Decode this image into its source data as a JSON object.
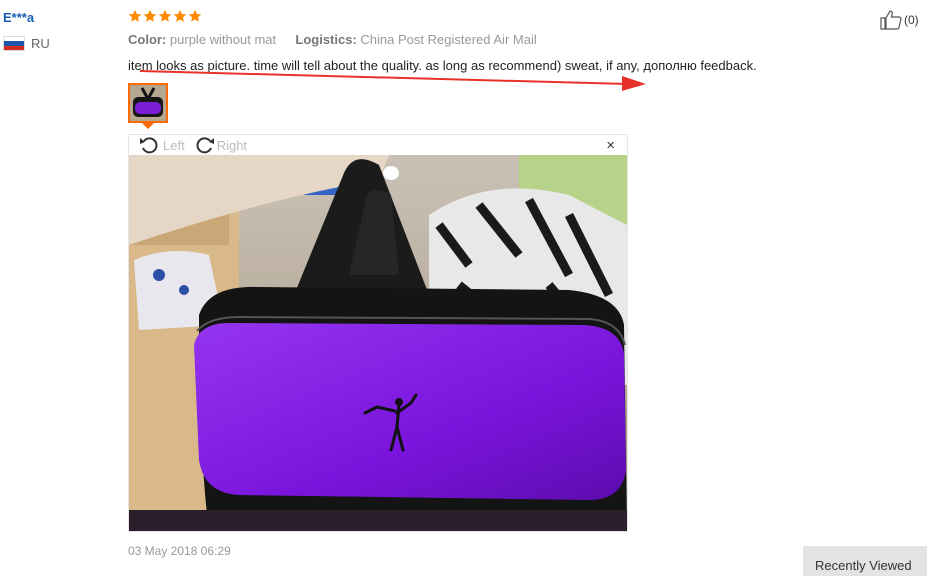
{
  "review": {
    "user_name": "E***a",
    "country_code": "RU",
    "rating": 5,
    "color_label": "Color:",
    "color_value": "purple without mat",
    "logistics_label": "Logistics:",
    "logistics_value": "China Post Registered Air Mail",
    "text": "item looks as picture. time will tell about the quality. as long as recommend) sweat, if any, дополню feedback.",
    "likes": "(0)",
    "date": "03 May 2018 06:29"
  },
  "viewer": {
    "rotate_left_label": "Left",
    "rotate_right_label": "Right",
    "close_label": "×"
  },
  "sidebar": {
    "recently_viewed_label": "Recently Viewed"
  },
  "colors": {
    "accent": "#ff6a00",
    "star": "#ff8a00",
    "link": "#1a5fb4",
    "annotation_arrow": "#e8312a"
  }
}
